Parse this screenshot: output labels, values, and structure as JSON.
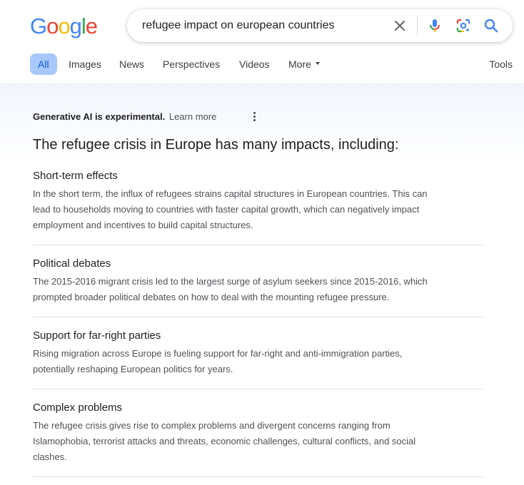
{
  "logo": {
    "letters": [
      "G",
      "o",
      "o",
      "g",
      "l",
      "e"
    ],
    "colors": [
      "#4285f4",
      "#ea4335",
      "#fbbc05",
      "#4285f4",
      "#34a853",
      "#ea4335"
    ]
  },
  "search": {
    "query": "refugee impact on european countries"
  },
  "search_icons": [
    "clear-icon",
    "microphone-icon",
    "lens-icon",
    "search-icon"
  ],
  "tabs": [
    "All",
    "Images",
    "News",
    "Perspectives",
    "Videos",
    "More"
  ],
  "tools_label": "Tools",
  "ai_overview": {
    "label": "Generative AI is experimental.",
    "learn_more": "Learn more",
    "heading": "The refugee crisis in Europe has many impacts, including:",
    "sections": [
      {
        "title": "Short-term effects",
        "lines": [
          "In the short term, the influx of refugees strains capital structures in European countries. This can",
          "lead to households moving to countries with faster capital growth, which can negatively impact",
          "employment and incentives to build capital structures."
        ]
      },
      {
        "title": "Political debates",
        "lines": [
          "The 2015-2016 migrant crisis led to the largest surge of asylum seekers since 2015-2016, which",
          "prompted broader political debates on how to deal with the mounting refugee pressure."
        ]
      },
      {
        "title": "Support for far-right parties",
        "lines": [
          "Rising migration across Europe is fueling support for far-right and anti-immigration parties,",
          "potentially reshaping European politics for years."
        ]
      },
      {
        "title": "Complex problems",
        "lines": [
          "The refugee crisis gives rise to complex problems and divergent concerns ranging from",
          "Islamophobia, terrorist attacks and threats, economic challenges, cultural conflicts, and social",
          "clashes."
        ]
      }
    ]
  },
  "accent_color": "#0b57d0",
  "active_tab_bg": "#a8c7fa"
}
